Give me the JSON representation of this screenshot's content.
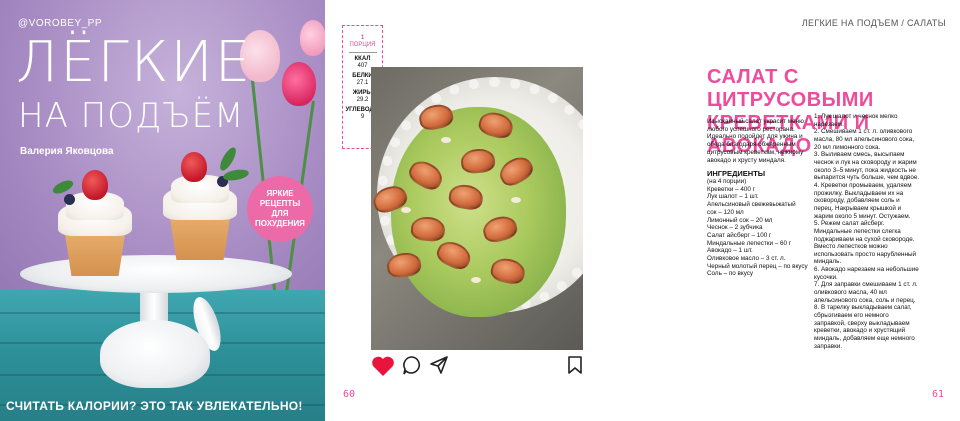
{
  "cover": {
    "handle": "@VOROBEY_PP",
    "title_line1": "ЛЁГКИЕ",
    "title_line2": "НА ПОДЪЁМ",
    "author": "Валерия Яковцова",
    "badge": "ЯРКИЕ РЕЦЕПТЫ ДЛЯ ПОХУДЕНИЯ",
    "bottom_slogan": "СЧИТАТЬ КАЛОРИИ? ЭТО ТАК УВЛЕКАТЕЛЬНО!"
  },
  "left_page": {
    "nutrition": {
      "portion_count": "1",
      "portion_label": "ПОРЦИЯ",
      "kcal_label": "ККАЛ",
      "kcal_value": "407",
      "protein_label": "БЕЛКИ",
      "protein_value": "27.1",
      "fat_label": "ЖИРЫ",
      "fat_value": "29.2",
      "carb_label": "УГЛЕВОДЫ",
      "carb_value": "9"
    },
    "page_number": "60",
    "icons": [
      "heart-icon",
      "comment-icon",
      "share-icon",
      "bookmark-icon"
    ],
    "accent_color": "#ec4c9b",
    "heart_color": "#e8143c"
  },
  "right_page": {
    "running_head": "ЛЕГКИЕ НА ПОДЪЕМ / САЛАТЫ",
    "title_line1": "САЛАТ С ЦИТРУСОВЫМИ",
    "title_line2": "КРЕВЕТКАМИ И АВОКАДО",
    "intro": "Изысканный салат украсит меню любого успешного ресторана. Идеально подойдет для ужина и обеда благодаря обжаренным цитрусовым креветкам, нежному авокадо и хрусту миндаля.",
    "ingredients_heading": "ИНГРЕДИЕНТЫ",
    "ingredients": [
      "(на 4 порции)",
      "Креветки – 400 г",
      "Лук шалот – 1 шт.",
      "Апельсиновый свежевыжатый",
      "сок – 120 мл",
      "Лимонный сок – 20 мл",
      "Чеснок – 2 зубчика",
      "Салат айсберг – 100 г",
      "Миндальные лепестки – 60 г",
      "Авокадо – 1 шт.",
      "Оливковое масло – 3 ст. л.",
      "Черный молотый перец – по вкусу",
      "Соль – по вкусу"
    ],
    "steps": [
      "1. Лук шалот и чеснок мелко нарезаем.",
      "2. Смешиваем 1 ст. л. оливкового масла, 80 мл апельсинового сока, 20 мл лимонного сока.",
      "3. Выливаем смесь, высыпаем чеснок и лук на сковороду и жарим около 3–5 минут, пока жидкость не выпарится чуть больше, чем вдвое.",
      "4. Креветки промываем, удаляем прожилку. Выкладываем их на сковороду, добавляем соль и перец. Накрываем крышкой и жарим около 5 минут. Остужаем.",
      "5. Режем салат айсберг. Миндальные лепестки слегка поджариваем на сухой сковороде. Вместо лепестков можно использовать просто нарубленный миндаль.",
      "6. Авокадо нарезаем на небольшие кусочки.",
      "7. Для заправки смешиваем 1 ст. л. оливкового масла, 40 мл апельсинового сока, соль и перец.",
      "8. В тарелку выкладываем салат, сбрызгиваем его немного заправкой, сверху выкладываем креветки, авокадо и хрустящий миндаль, добавляем еще немного заправки."
    ],
    "page_number": "61"
  }
}
